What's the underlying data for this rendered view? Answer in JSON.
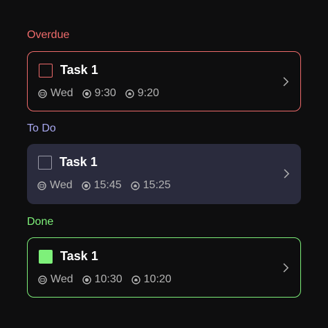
{
  "colors": {
    "background": "#0e0e0f",
    "overdue": "#ef6b6b",
    "todo_label": "#a8a8f0",
    "todo_card": "#2a2b3d",
    "done": "#7ef07a",
    "meta_text": "#b3b3b3"
  },
  "sections": [
    {
      "label": "Overdue",
      "task": {
        "title": "Task 1",
        "checked": false,
        "day": "Wed",
        "time": "9:30",
        "reminder": "9:20"
      }
    },
    {
      "label": "To Do",
      "task": {
        "title": "Task 1",
        "checked": false,
        "day": "Wed",
        "time": "15:45",
        "reminder": "15:25"
      }
    },
    {
      "label": "Done",
      "task": {
        "title": "Task 1",
        "checked": true,
        "day": "Wed",
        "time": "10:30",
        "reminder": "10:20"
      }
    }
  ],
  "icons": {
    "day": "calendar-icon",
    "time": "clock-icon",
    "reminder": "bell-icon",
    "open": "chevron-right-icon"
  }
}
